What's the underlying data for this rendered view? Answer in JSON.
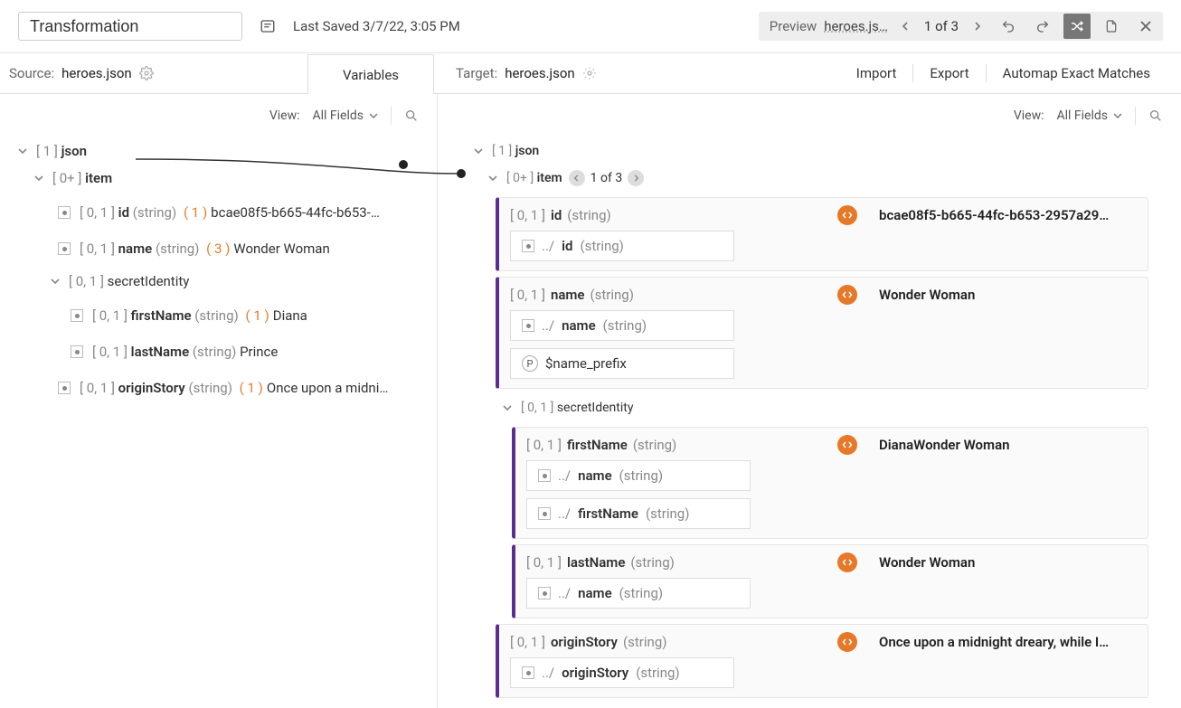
{
  "title": "Transformation",
  "saved": "Last Saved 3/7/22, 3:05 PM",
  "preview": {
    "label": "Preview",
    "file": "heroes.js…",
    "page": "1 of 3"
  },
  "source": {
    "label": "Source:",
    "file": "heroes.json"
  },
  "target": {
    "label": "Target:",
    "file": "heroes.json"
  },
  "variablesTab": "Variables",
  "actions": {
    "import": "Import",
    "export": "Export",
    "automap": "Automap Exact Matches"
  },
  "view": {
    "label": "View:",
    "value": "All Fields"
  },
  "leftTree": {
    "json": {
      "card": "[ 1 ]",
      "name": "json"
    },
    "item": {
      "card": "[ 0+ ]",
      "name": "item"
    },
    "id": {
      "card": "[ 0, 1 ]",
      "name": "id",
      "type": "(string)",
      "count": "( 1 )",
      "value": "bcae08f5-b665-44fc-b653-295…"
    },
    "name": {
      "card": "[ 0, 1 ]",
      "name": "name",
      "type": "(string)",
      "count": "( 3 )",
      "value": "Wonder Woman"
    },
    "secretIdentity": {
      "card": "[ 0, 1 ]",
      "name": "secretIdentity"
    },
    "firstName": {
      "card": "[ 0, 1 ]",
      "name": "firstName",
      "type": "(string)",
      "count": "( 1 )",
      "value": "Diana"
    },
    "lastName": {
      "card": "[ 0, 1 ]",
      "name": "lastName",
      "type": "(string)",
      "value": "Prince"
    },
    "originStory": {
      "card": "[ 0, 1 ]",
      "name": "originStory",
      "type": "(string)",
      "count": "( 1 )",
      "value": "Once upon a midnig…"
    }
  },
  "rightHead": {
    "json": {
      "card": "[ 1 ]",
      "name": "json"
    },
    "item": {
      "card": "[ 0+ ]",
      "name": "item",
      "page": "1 of 3"
    }
  },
  "rightCards": {
    "id": {
      "head_card": "[ 0, 1 ]",
      "head_name": "id",
      "head_type": "(string)",
      "preview": "bcae08f5-b665-44fc-b653-2957a2956…",
      "map1_path": "../",
      "map1_name": "id",
      "map1_type": "(string)"
    },
    "name": {
      "head_card": "[ 0, 1 ]",
      "head_name": "name",
      "head_type": "(string)",
      "preview": "Wonder Woman",
      "map1_path": "../",
      "map1_name": "name",
      "map1_type": "(string)",
      "var_name": "$name_prefix"
    },
    "secretIdentity": {
      "head_card": "[ 0, 1 ]",
      "head_name": "secretIdentity"
    },
    "firstName": {
      "head_card": "[ 0, 1 ]",
      "head_name": "firstName",
      "head_type": "(string)",
      "preview": "DianaWonder Woman",
      "map1_path": "../",
      "map1_name": "name",
      "map1_type": "(string)",
      "map2_path": "../",
      "map2_name": "firstName",
      "map2_type": "(string)"
    },
    "lastName": {
      "head_card": "[ 0, 1 ]",
      "head_name": "lastName",
      "head_type": "(string)",
      "preview": "Wonder Woman",
      "map1_path": "../",
      "map1_name": "name",
      "map1_type": "(string)"
    },
    "originStory": {
      "head_card": "[ 0, 1 ]",
      "head_name": "originStory",
      "head_type": "(string)",
      "preview": "Once upon a midnight dreary, while I…",
      "map1_path": "../",
      "map1_name": "originStory",
      "map1_type": "(string)"
    }
  }
}
